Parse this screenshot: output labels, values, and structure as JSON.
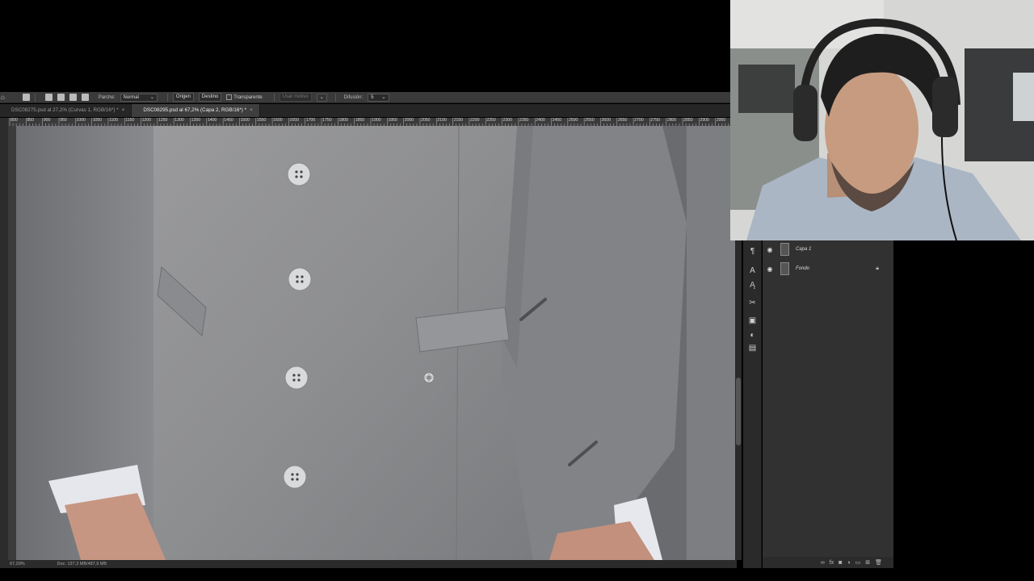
{
  "options_bar": {
    "tool_label": "Parche:",
    "mode_value": "Normal",
    "origin_button": "Origen",
    "dest_button": "Destino",
    "transparent_label": "Transparente",
    "use_pattern_label": "Usar motivo",
    "diffusion_label": "Difusión:",
    "diffusion_value": "5"
  },
  "tabs": [
    {
      "label": "DSC08275.psd al 27,2% (Curvas 1, RGB/16*) *",
      "close": "×"
    },
    {
      "label": "DSC08295.psd al 67,2% (Capa 2, RGB/16*) *",
      "close": "×"
    }
  ],
  "ruler_labels": [
    "800",
    "850",
    "900",
    "950",
    "1000",
    "1050",
    "1100",
    "1150",
    "1200",
    "1250",
    "1300",
    "1350",
    "1400",
    "1450",
    "1500",
    "1550",
    "1600",
    "1650",
    "1700",
    "1750",
    "1800",
    "1850",
    "1900",
    "1950",
    "2000",
    "2050",
    "2100",
    "2150",
    "2200",
    "2250",
    "2300",
    "2350",
    "2400",
    "2450",
    "2500",
    "2550",
    "2600",
    "2650",
    "2700",
    "2750",
    "2800",
    "2850",
    "2900",
    "2950"
  ],
  "status": {
    "zoom": "67,29%",
    "doc": "Doc: 137,3 MB/487,9 MB"
  },
  "layers": [
    {
      "name": "Capa 1",
      "visible_icon": "eye-icon",
      "locked": false
    },
    {
      "name": "Fondo",
      "visible_icon": "eye-icon",
      "locked": true
    }
  ],
  "layer_footer_icons": [
    "link-icon",
    "fx-icon",
    "mask-icon",
    "adjustment-icon",
    "folder-icon",
    "new-layer-icon",
    "trash-icon"
  ],
  "panel_strip_icons": [
    "paragraph-icon",
    "character-icon",
    "styles-icon",
    "scissors-icon",
    "image-icon",
    "adjust-icon",
    "info-icon"
  ]
}
